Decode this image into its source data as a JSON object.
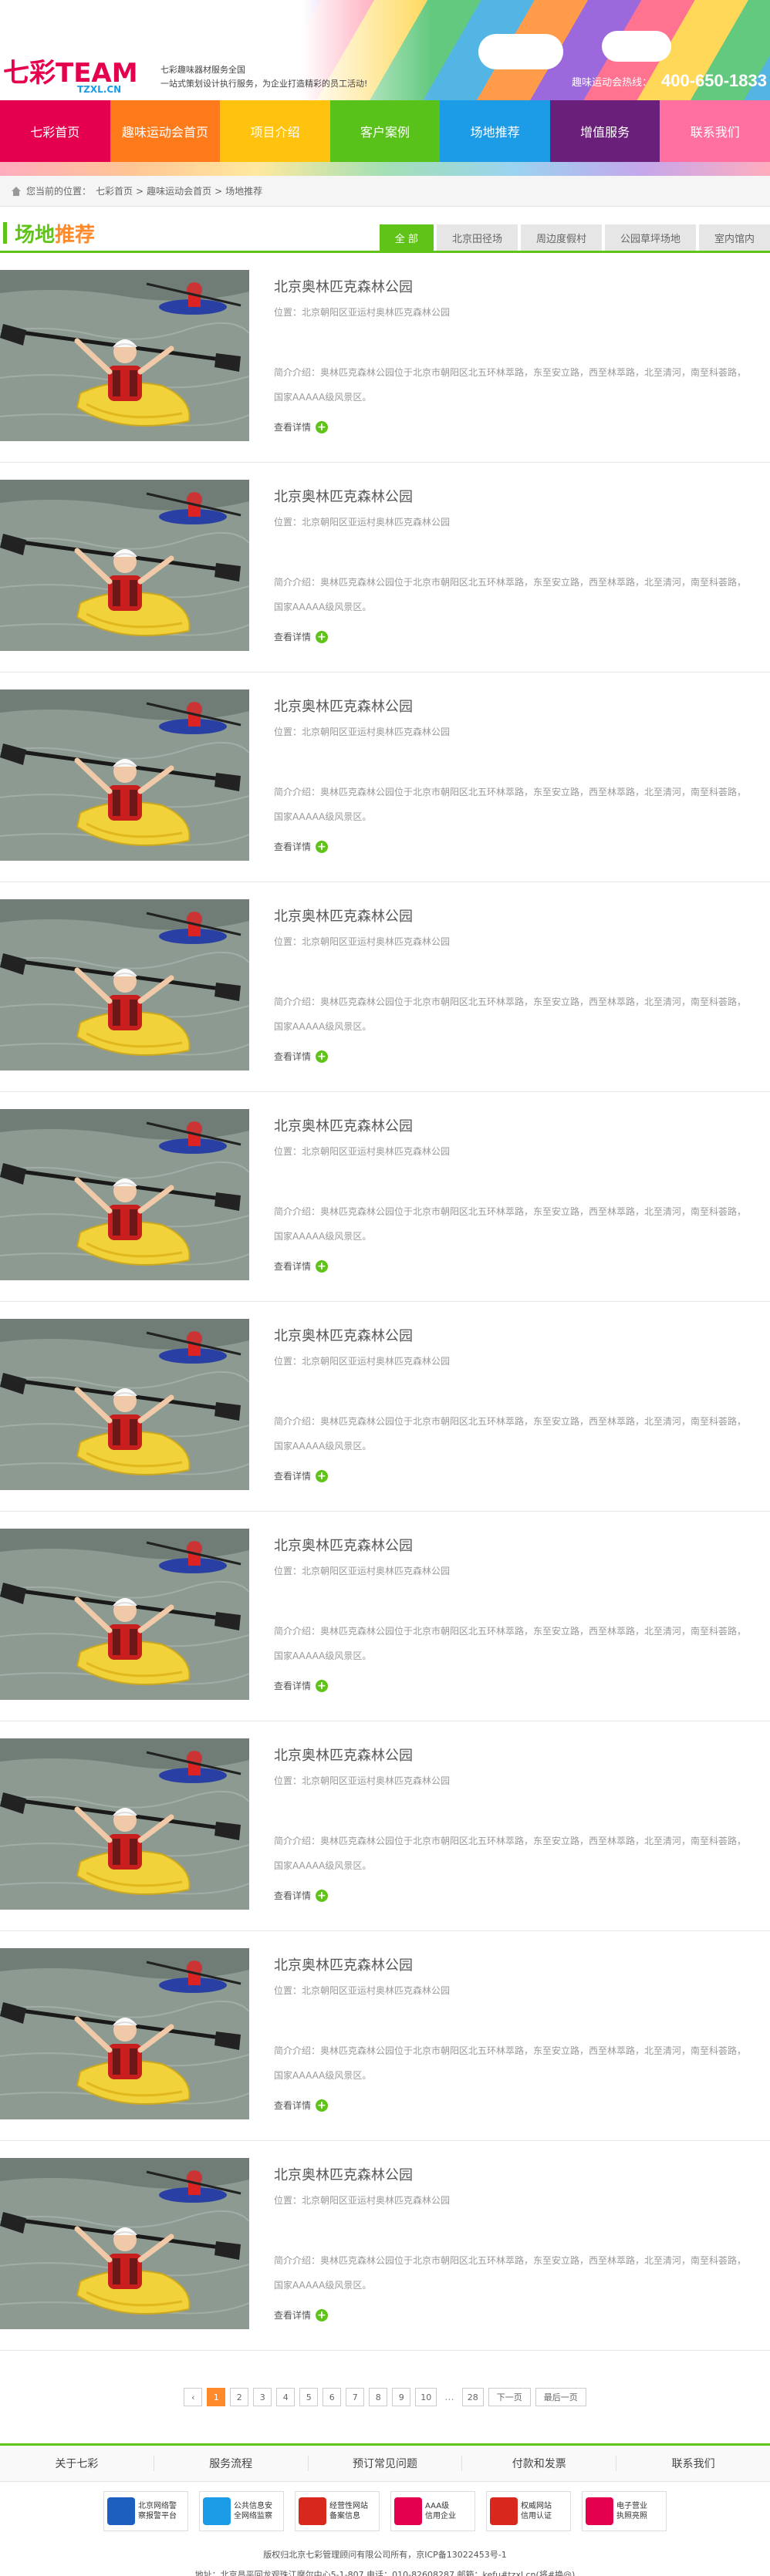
{
  "header": {
    "logo_text": "七彩TEAM",
    "logo_sub": "TZXL.CN",
    "slogan_line1": "七彩趣味器材服务全国",
    "slogan_line2": "一站式策划设计执行服务，为企业打造精彩的员工活动!",
    "hotline_label": "趣味运动会热线：",
    "hotline_number": "400-650-1833"
  },
  "nav": {
    "items": [
      {
        "label": "七彩首页",
        "color": "#e5004f"
      },
      {
        "label": "趣味运动会首页",
        "color": "#ff7a1a"
      },
      {
        "label": "项目介绍",
        "color": "#ffc20e"
      },
      {
        "label": "客户案例",
        "color": "#59c21a"
      },
      {
        "label": "场地推荐",
        "color": "#1c9be6"
      },
      {
        "label": "增值服务",
        "color": "#6a1f7a"
      },
      {
        "label": "联系我们",
        "color": "#ff6fa0"
      }
    ]
  },
  "breadcrumb": {
    "prefix": "您当前的位置：",
    "items": [
      "七彩首页",
      "趣味运动会首页",
      "场地推荐"
    ],
    "separator": ">"
  },
  "page_title": {
    "part1": "场地",
    "part2": "推荐"
  },
  "filters": [
    {
      "label": "全 部",
      "active": true
    },
    {
      "label": "北京田径场",
      "active": false
    },
    {
      "label": "周边度假村",
      "active": false
    },
    {
      "label": "公园草坪场地",
      "active": false
    },
    {
      "label": "室内馆内",
      "active": false
    }
  ],
  "items": [
    {
      "name": "北京奥林匹克森林公园",
      "location": "位置：北京朝阳区亚运村奥林匹克森林公园",
      "desc": "简介介绍：奥林匹克森林公园位于北京市朝阳区北五环林萃路，东至安立路，西至林萃路，北至清河，南至科荟路，国家AAAAA级风景区。",
      "more": "查看详情"
    },
    {
      "name": "北京奥林匹克森林公园",
      "location": "位置：北京朝阳区亚运村奥林匹克森林公园",
      "desc": "简介介绍：奥林匹克森林公园位于北京市朝阳区北五环林萃路，东至安立路，西至林萃路，北至清河，南至科荟路，国家AAAAA级风景区。",
      "more": "查看详情"
    },
    {
      "name": "北京奥林匹克森林公园",
      "location": "位置：北京朝阳区亚运村奥林匹克森林公园",
      "desc": "简介介绍：奥林匹克森林公园位于北京市朝阳区北五环林萃路，东至安立路，西至林萃路，北至清河，南至科荟路，国家AAAAA级风景区。",
      "more": "查看详情"
    },
    {
      "name": "北京奥林匹克森林公园",
      "location": "位置：北京朝阳区亚运村奥林匹克森林公园",
      "desc": "简介介绍：奥林匹克森林公园位于北京市朝阳区北五环林萃路，东至安立路，西至林萃路，北至清河，南至科荟路，国家AAAAA级风景区。",
      "more": "查看详情"
    },
    {
      "name": "北京奥林匹克森林公园",
      "location": "位置：北京朝阳区亚运村奥林匹克森林公园",
      "desc": "简介介绍：奥林匹克森林公园位于北京市朝阳区北五环林萃路，东至安立路，西至林萃路，北至清河，南至科荟路，国家AAAAA级风景区。",
      "more": "查看详情"
    },
    {
      "name": "北京奥林匹克森林公园",
      "location": "位置：北京朝阳区亚运村奥林匹克森林公园",
      "desc": "简介介绍：奥林匹克森林公园位于北京市朝阳区北五环林萃路，东至安立路，西至林萃路，北至清河，南至科荟路，国家AAAAA级风景区。",
      "more": "查看详情"
    },
    {
      "name": "北京奥林匹克森林公园",
      "location": "位置：北京朝阳区亚运村奥林匹克森林公园",
      "desc": "简介介绍：奥林匹克森林公园位于北京市朝阳区北五环林萃路，东至安立路，西至林萃路，北至清河，南至科荟路，国家AAAAA级风景区。",
      "more": "查看详情"
    },
    {
      "name": "北京奥林匹克森林公园",
      "location": "位置：北京朝阳区亚运村奥林匹克森林公园",
      "desc": "简介介绍：奥林匹克森林公园位于北京市朝阳区北五环林萃路，东至安立路，西至林萃路，北至清河，南至科荟路，国家AAAAA级风景区。",
      "more": "查看详情"
    },
    {
      "name": "北京奥林匹克森林公园",
      "location": "位置：北京朝阳区亚运村奥林匹克森林公园",
      "desc": "简介介绍：奥林匹克森林公园位于北京市朝阳区北五环林萃路，东至安立路，西至林萃路，北至清河，南至科荟路，国家AAAAA级风景区。",
      "more": "查看详情"
    },
    {
      "name": "北京奥林匹克森林公园",
      "location": "位置：北京朝阳区亚运村奥林匹克森林公园",
      "desc": "简介介绍：奥林匹克森林公园位于北京市朝阳区北五环林萃路，东至安立路，西至林萃路，北至清河，南至科荟路，国家AAAAA级风景区。",
      "more": "查看详情"
    }
  ],
  "pagination": {
    "prev_icon": "‹",
    "pages": [
      "1",
      "2",
      "3",
      "4",
      "5",
      "6",
      "7",
      "8",
      "9",
      "10"
    ],
    "current": "1",
    "ellipsis": "...",
    "last_page": "28",
    "next_label": "下一页",
    "last_label": "最后一页"
  },
  "footer_nav": [
    "关于七彩",
    "服务流程",
    "预订常见问题",
    "付款和发票",
    "联系我们"
  ],
  "badges": [
    {
      "line1": "北京网络警",
      "line2": "察报警平台",
      "color": "#1c5fbf"
    },
    {
      "line1": "公共信息安",
      "line2": "全网络监察",
      "color": "#1c9be6"
    },
    {
      "line1": "经营性网站",
      "line2": "备案信息",
      "color": "#d8281e"
    },
    {
      "line1": "AAA级",
      "line2": "信用企业",
      "color": "#e5004f"
    },
    {
      "line1": "权威网站",
      "line2": "信用认证",
      "color": "#d8281e"
    },
    {
      "line1": "电子营业",
      "line2": "执照亮照",
      "color": "#e5004f"
    }
  ],
  "copyright": "版权归北京七彩管理顾问有限公司所有，京ICP备13022453号-1",
  "address": "地址：北京昌平回龙观珠江摩尔中心5-1-807    电话：010-82608287    邮箱：kefu#tzxl.cn(将#换@)"
}
